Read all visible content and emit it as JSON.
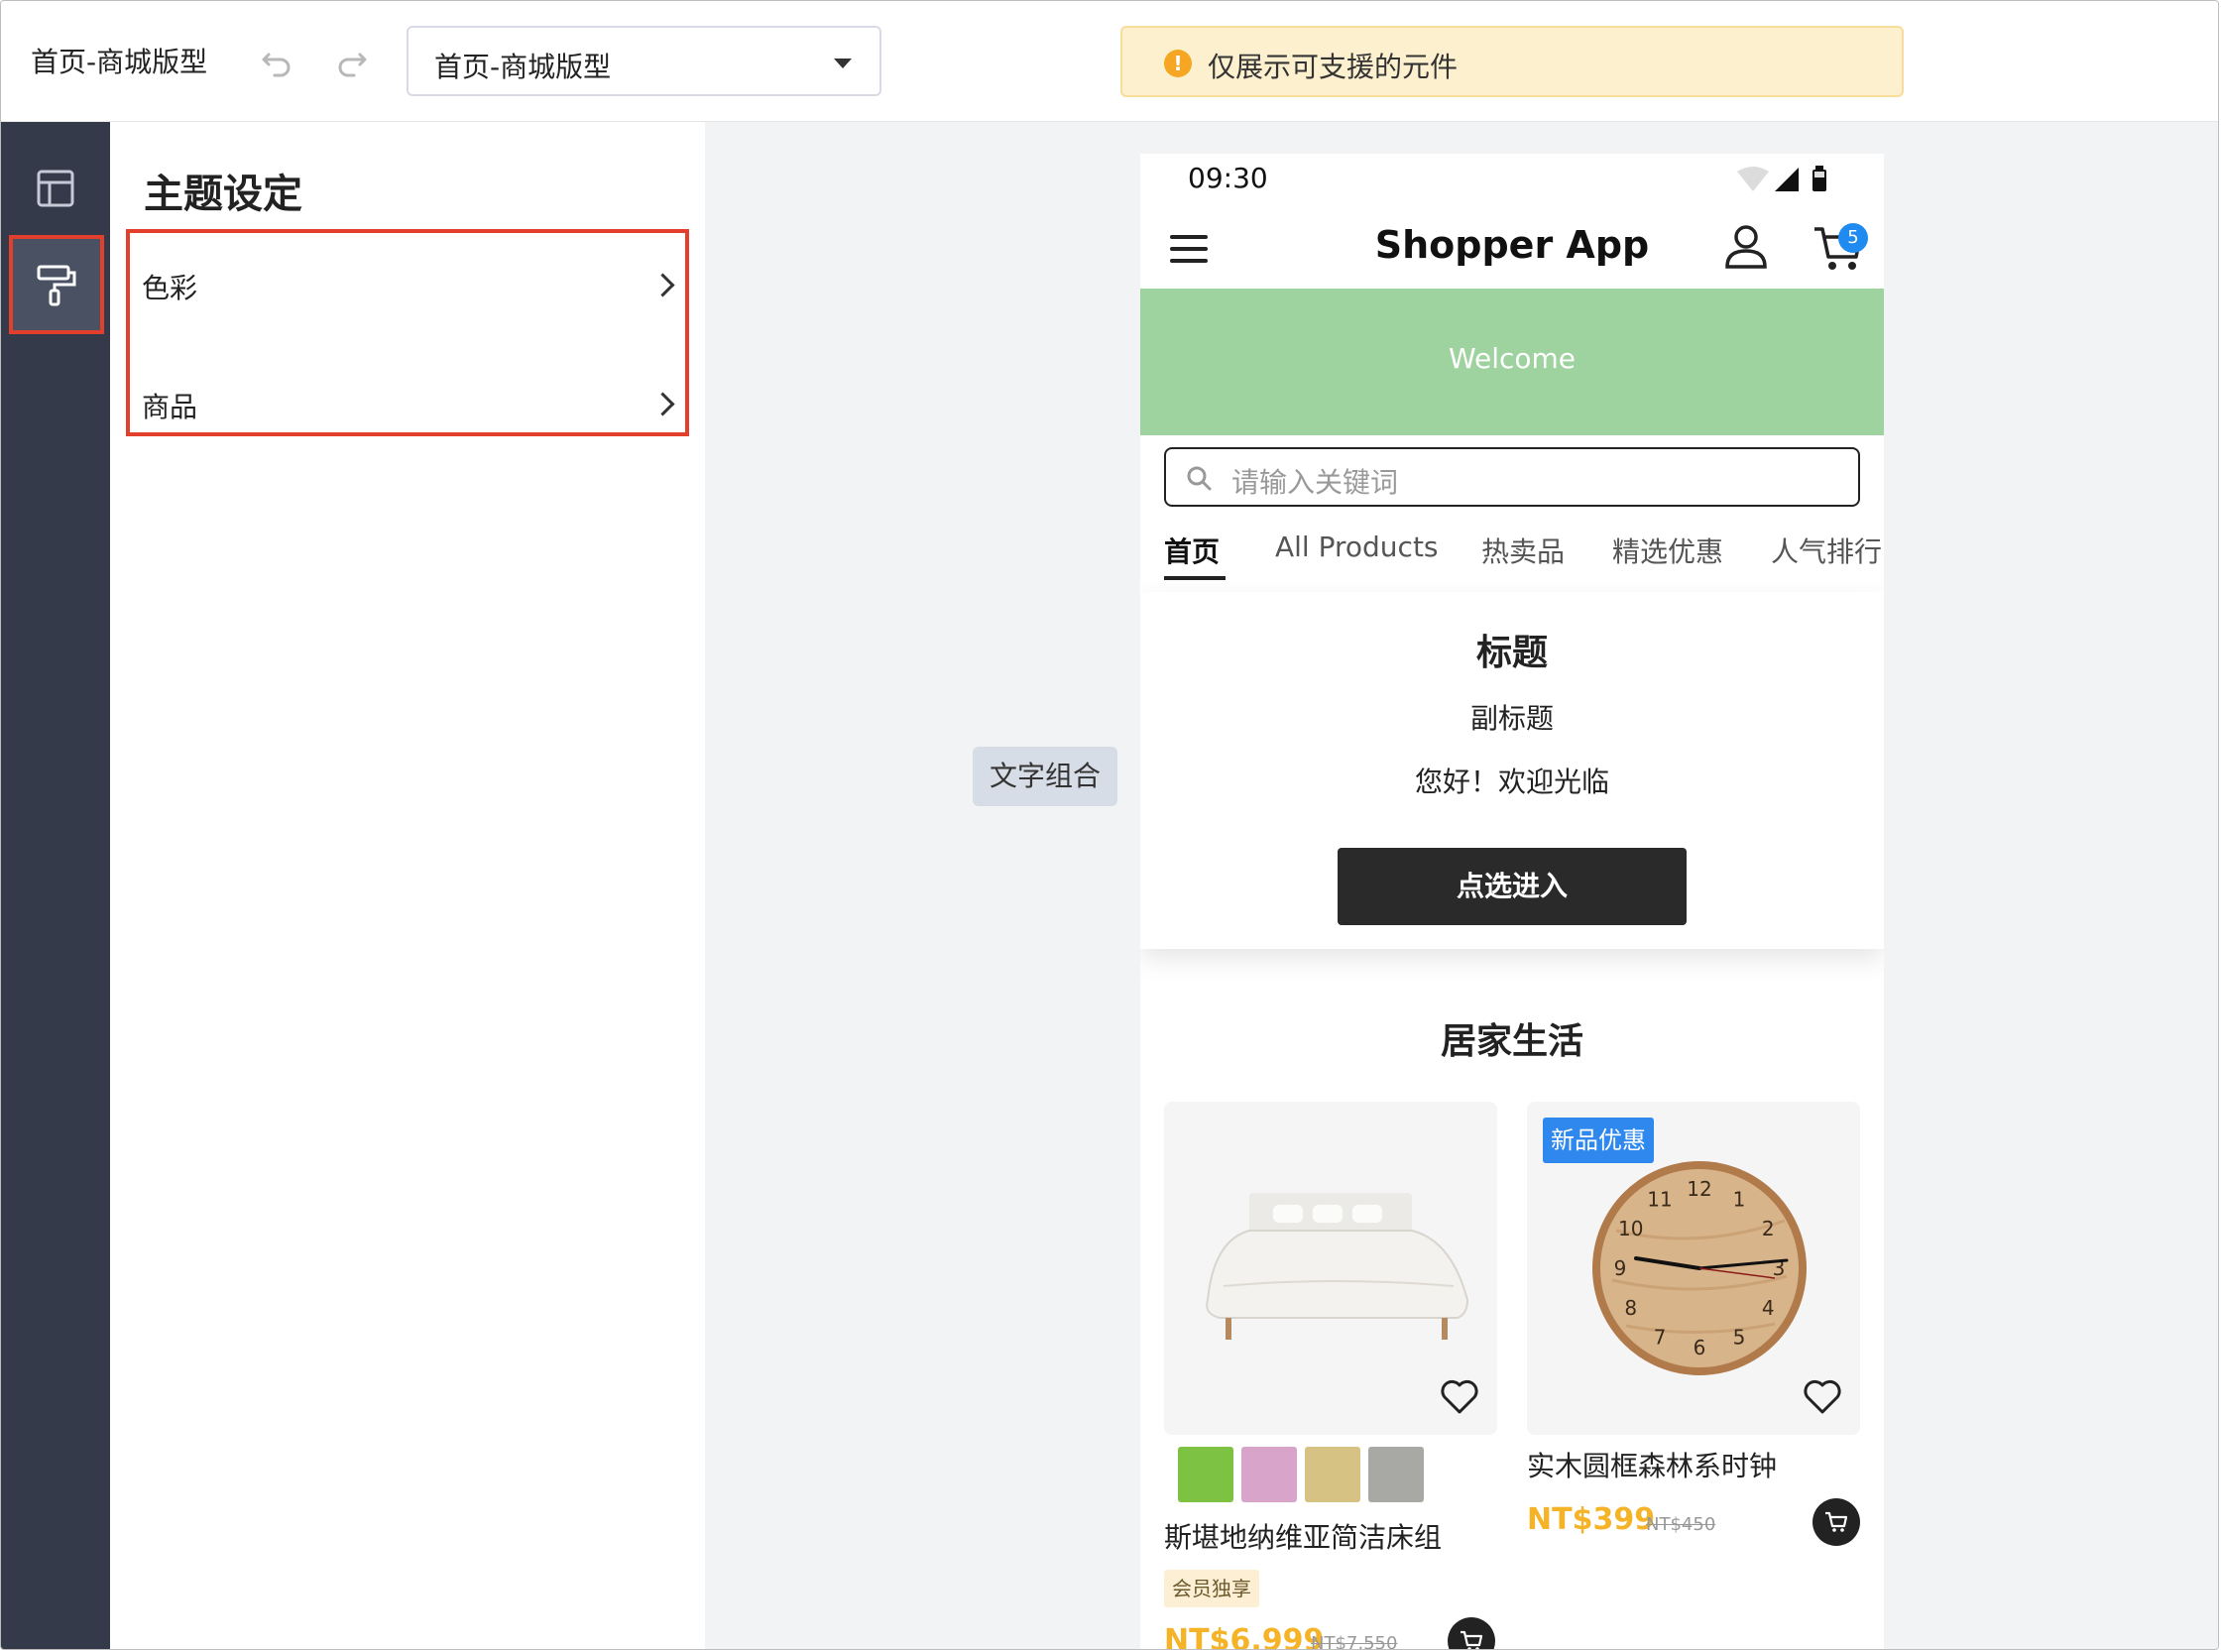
{
  "toolbar": {
    "page_title": "首页-商城版型",
    "page_select_value": "首页-商城版型",
    "notice": "仅展示可支援的元件",
    "warn_glyph": "!"
  },
  "sidebar": {
    "icons": [
      "layout-icon",
      "paint-roller-icon"
    ],
    "active": "paint-roller-icon",
    "highlight_color": "#e2402d"
  },
  "panel": {
    "title": "主题设定",
    "items": [
      {
        "label": "色彩"
      },
      {
        "label": "商品"
      }
    ]
  },
  "canvas": {
    "text_group_tag": "文字组合"
  },
  "phone": {
    "status_time": "09:30",
    "app_title": "Shopper App",
    "cart_count": "5",
    "banner_text": "Welcome",
    "search_placeholder": "请输入关键词",
    "tabs": [
      "首页",
      "All Products",
      "热卖品",
      "精选优惠",
      "人气排行"
    ],
    "active_tab": "首页",
    "card": {
      "title": "标题",
      "subtitle": "副标题",
      "greeting": "您好！欢迎光临",
      "cta": "点选进入"
    },
    "section_title": "居家生活",
    "products": [
      {
        "name": "斯堪地纳维亚简洁床组",
        "badge": "会员独享",
        "price": "NT$6,999",
        "old_price": "NT$7,550",
        "swatches": [
          "#7dc243",
          "#d9a4c9",
          "#d6c283",
          "#a8a8a5"
        ]
      },
      {
        "name": "实木圆框森林系时钟",
        "tag": "新品优惠",
        "price": "NT$399",
        "old_price": "NT$450",
        "clock_numbers": [
          "12",
          "1",
          "2",
          "3",
          "4",
          "5",
          "6",
          "7",
          "8",
          "9",
          "10",
          "11"
        ]
      }
    ],
    "colors": {
      "banner": "#9ed29f",
      "price": "#f5b328",
      "badge_blue": "#1f8bf0"
    }
  }
}
